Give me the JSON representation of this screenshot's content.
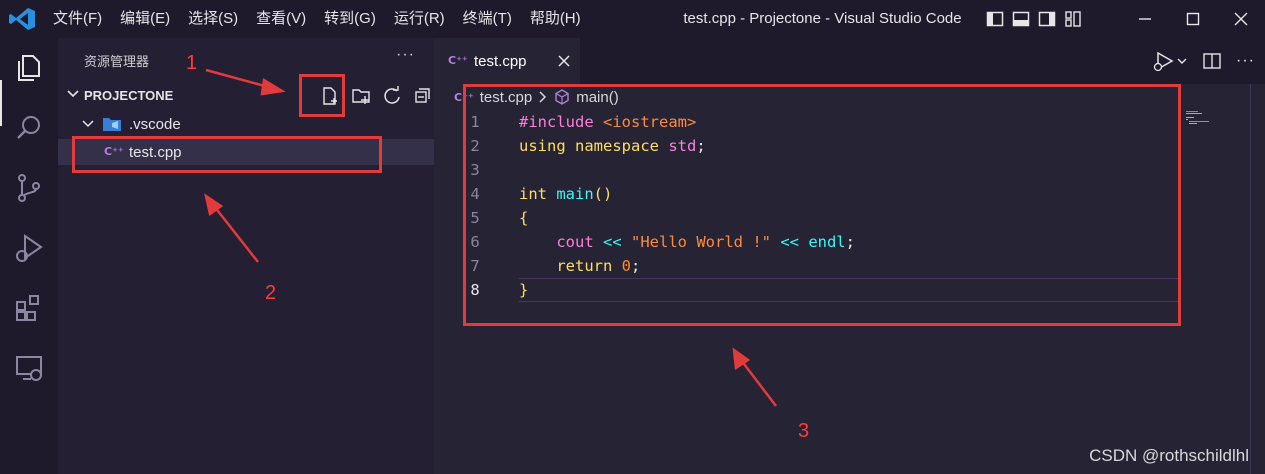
{
  "titlebar": {
    "menu": [
      "文件(F)",
      "编辑(E)",
      "选择(S)",
      "查看(V)",
      "转到(G)",
      "运行(R)",
      "终端(T)",
      "帮助(H)"
    ],
    "window_title": "test.cpp - Projectone - Visual Studio Code"
  },
  "sidebar": {
    "title": "资源管理器",
    "more": "···",
    "section_label": "PROJECTONE",
    "tree": [
      {
        "label": ".vscode",
        "type": "folder"
      },
      {
        "label": "test.cpp",
        "type": "file",
        "badge": "C⁺⁺"
      }
    ]
  },
  "editor": {
    "tab_label": "test.cpp",
    "tab_badge": "C⁺⁺",
    "breadcrumb": {
      "file": "test.cpp",
      "symbol": "main()"
    },
    "line_numbers": [
      "1",
      "2",
      "3",
      "4",
      "5",
      "6",
      "7",
      "8"
    ],
    "lines": [
      [
        {
          "t": "#include ",
          "c": "k-pink"
        },
        {
          "t": "<iostream>",
          "c": "k-orange"
        }
      ],
      [
        {
          "t": "using namespace ",
          "c": "k-yellow"
        },
        {
          "t": "std",
          "c": "k-pink"
        },
        {
          "t": ";",
          "c": "k-plain"
        }
      ],
      [],
      [
        {
          "t": "int ",
          "c": "k-yellow"
        },
        {
          "t": "main",
          "c": "k-cyan"
        },
        {
          "t": "()",
          "c": "k-yellow"
        }
      ],
      [
        {
          "t": "{",
          "c": "k-yellow"
        }
      ],
      [
        {
          "t": "    ",
          "c": "k-plain"
        },
        {
          "t": "cout ",
          "c": "k-pink"
        },
        {
          "t": "<< ",
          "c": "k-cyan"
        },
        {
          "t": "\"Hello World !\" ",
          "c": "k-str"
        },
        {
          "t": "<< ",
          "c": "k-cyan"
        },
        {
          "t": "endl",
          "c": "k-cyan"
        },
        {
          "t": ";",
          "c": "k-plain"
        }
      ],
      [
        {
          "t": "    ",
          "c": "k-plain"
        },
        {
          "t": "return ",
          "c": "k-yellow"
        },
        {
          "t": "0",
          "c": "k-orange"
        },
        {
          "t": ";",
          "c": "k-plain"
        }
      ],
      [
        {
          "t": "}",
          "c": "k-yellow"
        }
      ]
    ],
    "active_line": 8
  },
  "annotations": {
    "n1": "1",
    "n2": "2",
    "n3": "3"
  },
  "watermark": "CSDN @rothschildlhl",
  "colors": {
    "annotation_red": "#e23b3b",
    "titlebar_bg": "#1e1a2c",
    "editor_bg": "#262335"
  }
}
